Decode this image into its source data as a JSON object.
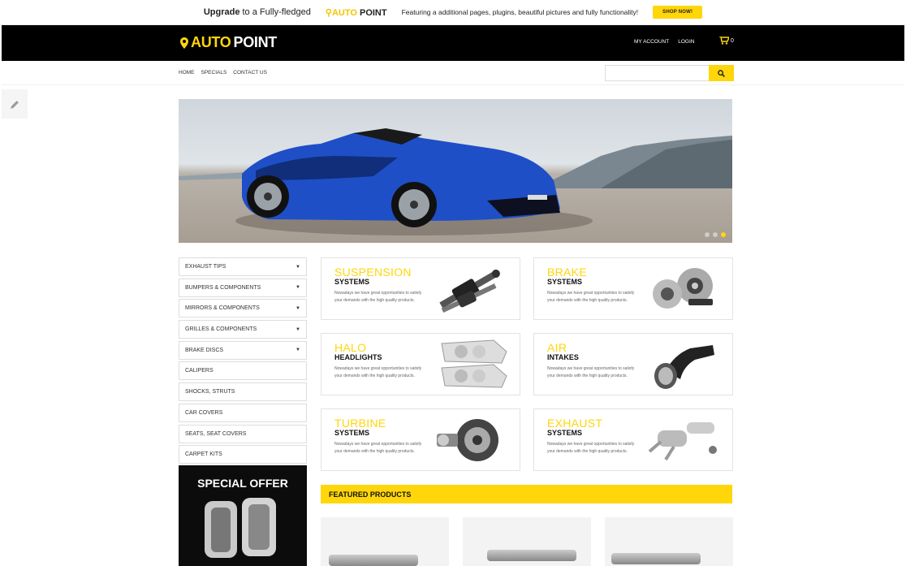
{
  "promo": {
    "upgrade": "Upgrade",
    "text": "to a Fully-fledged",
    "brand_auto": "AUTO",
    "brand_point": "POINT",
    "features": "Featuring a additional pages, plugins, beautiful pictures and fully functionality!",
    "shop_label": "SHOP NOW!"
  },
  "header": {
    "logo_auto": "AUTO",
    "logo_point": "POINT",
    "my_account": "MY ACCOUNT",
    "login": "LOGIN",
    "cart_count": "0"
  },
  "nav": {
    "items": [
      "HOME",
      "SPECIALS",
      "CONTACT US"
    ],
    "search_placeholder": ""
  },
  "hero": {
    "slides": 3,
    "active_slide": 3
  },
  "sidebar": {
    "categories": [
      {
        "label": "EXHAUST TIPS",
        "caret": "▼"
      },
      {
        "label": "BUMPERS & COMPONENTS",
        "caret": "▼"
      },
      {
        "label": "MIRRORS & COMPONENTS",
        "caret": "▼"
      },
      {
        "label": "GRILLES & COMPONENTS",
        "caret": "▼"
      },
      {
        "label": "BRAKE DISCS",
        "caret": "▼"
      },
      {
        "label": "CALIPERS",
        "caret": ""
      },
      {
        "label": "SHOCKS, STRUTS",
        "caret": ""
      },
      {
        "label": "CAR COVERS",
        "caret": ""
      },
      {
        "label": "SEATS, SEAT COVERS",
        "caret": ""
      },
      {
        "label": "CARPET KITS",
        "caret": ""
      }
    ]
  },
  "special_offer": {
    "title": "SPECIAL OFFER"
  },
  "cards": [
    {
      "h1": "SUSPENSION",
      "h2": "SYSTEMS",
      "desc": "Nowadays we have great opportunities to satisfy your demands with the high quality products."
    },
    {
      "h1": "BRAKE",
      "h2": "SYSTEMS",
      "desc": "Nowadays we have great opportunities to satisfy your demands with the high quality products."
    },
    {
      "h1": "HALO",
      "h2": "HEADLIGHTS",
      "desc": "Nowadays we have great opportunities to satisfy your demands with the high quality products."
    },
    {
      "h1": "AIR",
      "h2": "INTAKES",
      "desc": "Nowadays we have great opportunities to satisfy your demands with the high quality products."
    },
    {
      "h1": "TURBINE",
      "h2": "SYSTEMS",
      "desc": "Nowadays we have great opportunities to satisfy your demands with the high quality products."
    },
    {
      "h1": "EXHAUST",
      "h2": "SYSTEMS",
      "desc": "Nowadays we have great opportunities to satisfy your demands with the high quality products."
    }
  ],
  "featured": {
    "title": "FEATURED PRODUCTS"
  },
  "colors": {
    "accent": "#ffd60a",
    "header_bg": "#000000"
  }
}
